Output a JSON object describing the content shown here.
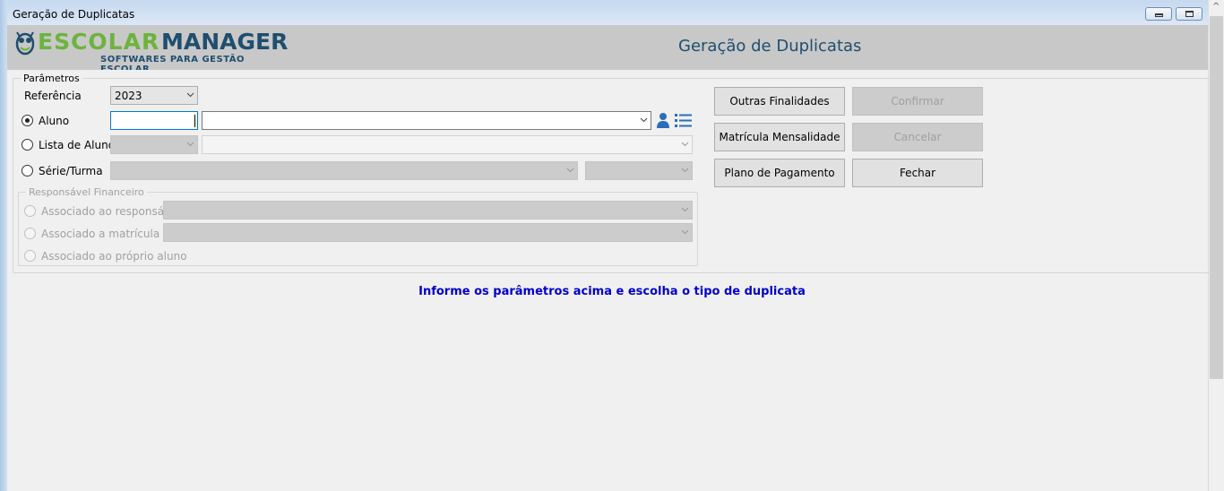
{
  "window": {
    "title": "Geração de Duplicatas"
  },
  "header": {
    "logo_word1": "ESCOLAR",
    "logo_word2": "MANAGER",
    "logo_tagline": "SOFTWARES PARA GESTÃO ESCOLAR",
    "title": "Geração de Duplicatas"
  },
  "params": {
    "legend": "Parâmetros",
    "referencia_label": "Referência",
    "referencia_value": "2023",
    "aluno_label": "Aluno",
    "lista_label": "Lista de Alunos",
    "serie_label": "Série/Turma"
  },
  "responsavel": {
    "legend": "Responsável Financeiro",
    "opt1": "Associado ao responsável",
    "opt2": "Associado a matrícula",
    "opt3": "Associado ao próprio aluno"
  },
  "buttons": {
    "outras": "Outras Finalidades",
    "confirmar": "Confirmar",
    "matricula": "Matrícula Mensalidade",
    "cancelar": "Cancelar",
    "plano": "Plano de Pagamento",
    "fechar": "Fechar"
  },
  "info_message": "Informe os parâmetros acima e escolha o tipo de duplicata",
  "colors": {
    "header_bg": "#c8c8c8",
    "brand_green": "#6db33f",
    "brand_blue": "#1f4e6e",
    "info_blue": "#0000cc",
    "icon_blue": "#2a6ebb"
  },
  "icons": [
    "minimize-icon",
    "maximize-icon",
    "owl-logo-icon",
    "user-icon",
    "list-icon",
    "chevron-down-icon",
    "scroll-up-icon"
  ]
}
